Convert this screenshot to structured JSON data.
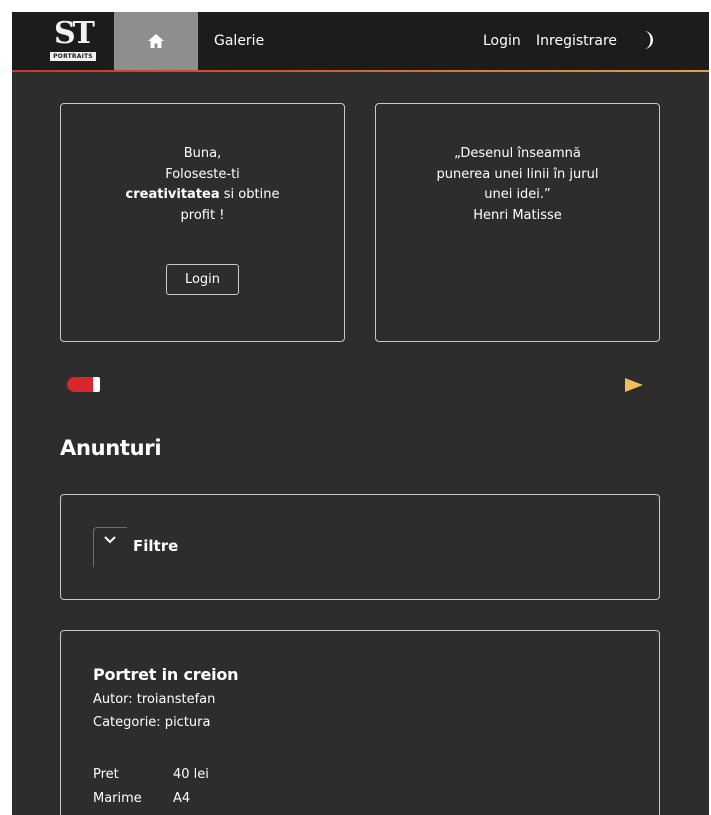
{
  "brand": {
    "logo_letters": "ST",
    "logo_sub": "PORTRAITS"
  },
  "nav": {
    "home_icon": "home-icon",
    "galerie": "Galerie",
    "login": "Login",
    "register": "Inregistrare",
    "theme_icon": "moon-icon"
  },
  "colors": {
    "background": "#2d2d2d",
    "navbar": "#1c1c1c",
    "home_active": "#8e8e8e",
    "accent_red": "#d9262a",
    "accent_gold": "#f1bf5c"
  },
  "carousel": {
    "greeting": {
      "line1": "Buna,",
      "line2": "Foloseste-ti",
      "highlight": "creativitatea",
      "line3_rest": " si obtine",
      "line4": "profit !",
      "button": "Login"
    },
    "quote": {
      "line1": "„Desenul înseamnă",
      "line2": "punerea unei linii în jurul",
      "line3": "unei idei.”",
      "author": "Henri Matisse"
    },
    "indicator_icon": "carousel-indicator",
    "next_icon": "play-arrow-icon"
  },
  "ads": {
    "title": "Anunturi",
    "filters": {
      "toggle_icon": "chevron-down-icon",
      "label": "Filtre"
    },
    "listing": {
      "title": "Portret in creion",
      "author": "Autor: troianstefan",
      "category": "Categorie: pictura",
      "price_label": "Pret",
      "price_value": "40 lei",
      "size_label": "Marime",
      "size_value": "A4"
    }
  }
}
